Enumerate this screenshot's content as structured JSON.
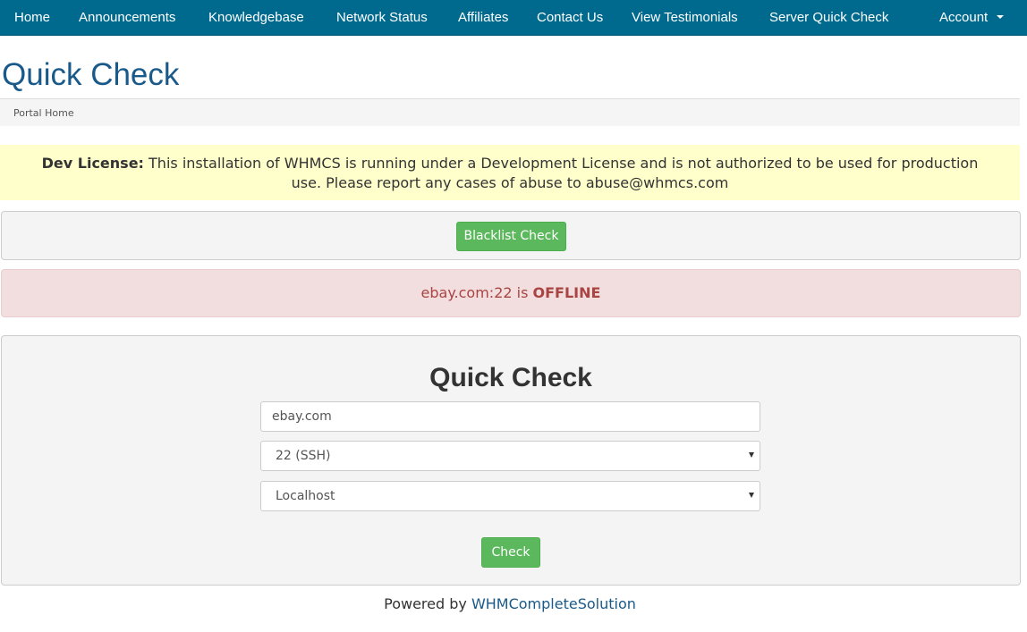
{
  "nav": {
    "items": [
      {
        "label": "Home"
      },
      {
        "label": "Announcements"
      },
      {
        "label": "Knowledgebase"
      },
      {
        "label": "Network Status"
      },
      {
        "label": "Affiliates"
      },
      {
        "label": "Contact Us"
      },
      {
        "label": "View Testimonials"
      },
      {
        "label": "Server Quick Check"
      }
    ],
    "account": {
      "label": "Account",
      "icon": "caret-down-icon"
    }
  },
  "page": {
    "title": "Quick Check",
    "breadcrumb": [
      "Portal Home"
    ]
  },
  "license_notice": {
    "label": "Dev License:",
    "text": "This installation of WHMCS is running under a Development License and is not authorized to be used for production use. Please report any cases of abuse to abuse@whmcs.com"
  },
  "blacklist": {
    "button_label": "Blacklist Check"
  },
  "status_alert": {
    "target": "ebay.com:22",
    "connector": "is",
    "status": "OFFLINE"
  },
  "quick_check_form": {
    "title": "Quick Check",
    "host_value": "ebay.com",
    "port_selected": "22 (SSH)",
    "location_selected": "Localhost",
    "submit_label": "Check"
  },
  "footer": {
    "prefix": "Powered by",
    "link_label": "WHMCompleteSolution"
  },
  "colors": {
    "navbar": "#006a8e",
    "title": "#1a5a8a",
    "license_bg": "#ffffcc",
    "alert_bg": "#f2dede",
    "alert_text": "#a94442",
    "button_green": "#5cb85c"
  }
}
